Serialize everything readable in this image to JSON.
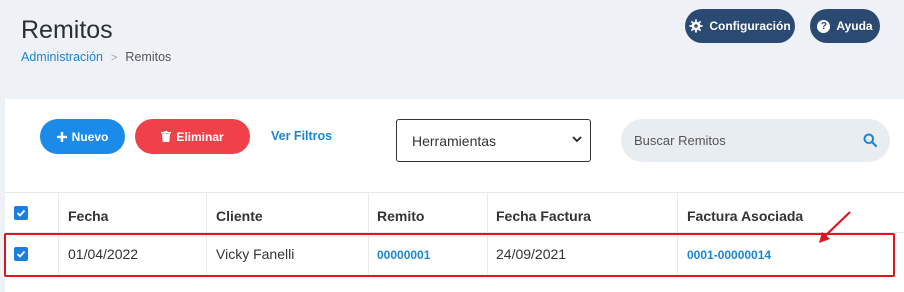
{
  "header": {
    "title": "Remitos",
    "breadcrumb": {
      "parent": "Administración",
      "separator": ">",
      "current": "Remitos"
    },
    "config_label": "Configuración",
    "help_label": "Ayuda"
  },
  "toolbar": {
    "new_label": "Nuevo",
    "delete_label": "Eliminar",
    "filters_label": "Ver Filtros",
    "select_value": "Herramientas",
    "search_placeholder": "Buscar Remitos"
  },
  "table": {
    "columns": [
      "Fecha",
      "Cliente",
      "Remito",
      "Fecha Factura",
      "Factura Asociada"
    ],
    "rows": [
      {
        "checked": true,
        "fecha": "01/04/2022",
        "cliente": "Vicky Fanelli",
        "remito": "00000001",
        "fecha_factura": "24/09/2021",
        "factura_asociada": "0001-00000014"
      }
    ]
  },
  "colors": {
    "primary": "#1a8be8",
    "danger": "#f04049",
    "dark_button": "#2b4a72",
    "link": "#1a86d6",
    "highlight": "#e0141e"
  }
}
